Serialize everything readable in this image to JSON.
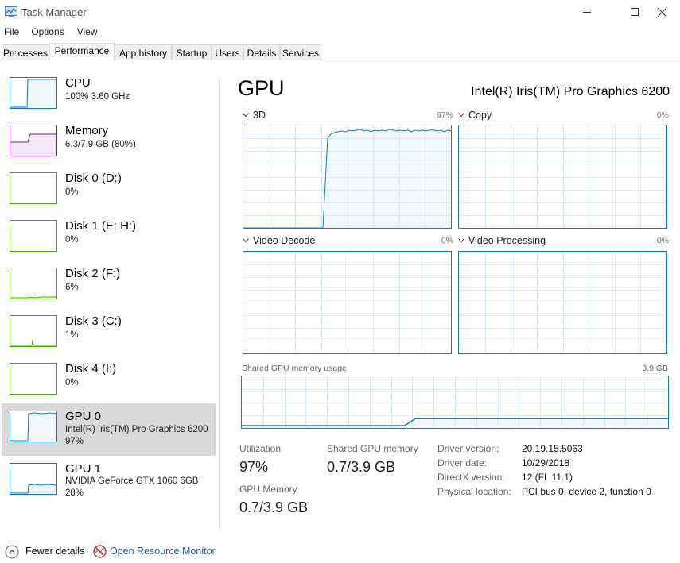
{
  "window": {
    "title": "Task Manager"
  },
  "menu": [
    "File",
    "Options",
    "View"
  ],
  "tabs": [
    "Processes",
    "Performance",
    "App history",
    "Startup",
    "Users",
    "Details",
    "Services"
  ],
  "active_tab": "Performance",
  "sidebar": {
    "items": [
      {
        "title": "CPU",
        "line1": "100% 3.60 GHz",
        "line2": "",
        "color": "#117dbb"
      },
      {
        "title": "Memory",
        "line1": "6.3/7.9 GB (80%)",
        "line2": "",
        "color": "#8b12ae"
      },
      {
        "title": "Disk 0 (D:)",
        "line1": "0%",
        "line2": "",
        "color": "#4da60c"
      },
      {
        "title": "Disk 1 (E: H:)",
        "line1": "0%",
        "line2": "",
        "color": "#4da60c"
      },
      {
        "title": "Disk 2 (F:)",
        "line1": "6%",
        "line2": "",
        "color": "#4da60c"
      },
      {
        "title": "Disk 3 (C:)",
        "line1": "1%",
        "line2": "",
        "color": "#4da60c"
      },
      {
        "title": "Disk 4 (I:)",
        "line1": "0%",
        "line2": "",
        "color": "#4da60c"
      },
      {
        "title": "GPU 0",
        "line1": "Intel(R) Iris(TM) Pro Graphics 6200",
        "line2": "97%",
        "color": "#117dbb"
      },
      {
        "title": "GPU 1",
        "line1": "NVIDIA GeForce GTX 1060 6GB",
        "line2": "28%",
        "color": "#117dbb"
      }
    ],
    "selected_index": 7
  },
  "main": {
    "title": "GPU",
    "device_name": "Intel(R) Iris(TM) Pro Graphics 6200",
    "engines": [
      {
        "label": "3D",
        "percent": "97%",
        "level": 97
      },
      {
        "label": "Copy",
        "percent": "0%",
        "level": 0
      },
      {
        "label": "Video Decode",
        "percent": "0%",
        "level": 0
      },
      {
        "label": "Video Processing",
        "percent": "0%",
        "level": 0
      }
    ],
    "shared_memory": {
      "label": "Shared GPU memory usage",
      "max": "3.9 GB",
      "used_fraction": 0.18
    },
    "stats": {
      "utilization_label": "Utilization",
      "utilization_value": "97%",
      "shared_label": "Shared GPU memory",
      "shared_value": "0.7/3.9 GB",
      "gpu_memory_label": "GPU Memory",
      "gpu_memory_value": "0.7/3.9 GB"
    },
    "info": [
      {
        "key": "Driver version:",
        "value": "20.19.15.5063"
      },
      {
        "key": "Driver date:",
        "value": "10/29/2018"
      },
      {
        "key": "DirectX version:",
        "value": "12 (FL 11.1)"
      },
      {
        "key": "Physical location:",
        "value": "PCI bus 0, device 2, function 0"
      }
    ]
  },
  "footer": {
    "fewer_details": "Fewer details",
    "open_resource_monitor": "Open Resource Monitor"
  },
  "colors": {
    "accent": "#117dbb",
    "grid": "#d9eaf4",
    "fill": "#f1f6fa",
    "link": "#1a64b5",
    "selected": "#d9d9d9"
  }
}
